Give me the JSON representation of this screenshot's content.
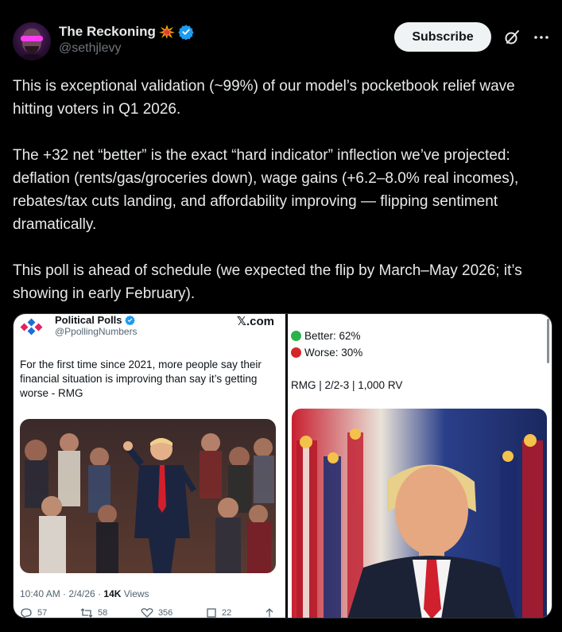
{
  "author": {
    "display_name": "The Reckoning",
    "handle": "@sethjlevy",
    "badge_icon": "burst-icon",
    "verified_icon": "verified-badge-icon",
    "verified_color": "#1d9bf0"
  },
  "actions": {
    "subscribe_label": "Subscribe",
    "grok_icon": "grok-icon",
    "more_icon": "more-icon"
  },
  "post": {
    "paragraphs": [
      "This is exceptional validation (~99%) of our model’s pocketbook relief wave hitting voters in Q1 2026.",
      "The +32 net “better” is the exact “hard indicator” inflection we’ve projected: deflation (rents/gas/groceries down), wage gains (+6.2–8.0% real incomes), rebates/tax cuts landing, and affordability improving — flipping sentiment dramatically.",
      "This poll is ahead of schedule (we expected the flip by March–May 2026; it’s showing in early February)."
    ]
  },
  "embedded_left": {
    "name": "Political Polls",
    "handle": "@PpollingNumbers",
    "site_label": "𝕏.com",
    "text": "For the first time since 2021, more people say their financial situation is improving than say it’s getting worse - RMG",
    "meta_time": "10:40 AM · 2/4/26 · ",
    "meta_views_count": "14K",
    "meta_views_label": " Views",
    "stats": {
      "replies": "57",
      "reposts": "58",
      "likes": "356",
      "bookmarks": "22"
    }
  },
  "embedded_right": {
    "better_label": "Better: 62%",
    "worse_label": "Worse: 30%",
    "better_color": "#2bb24c",
    "worse_color": "#d42828",
    "source_line": "RMG | 2/2-3 | 1,000 RV"
  }
}
